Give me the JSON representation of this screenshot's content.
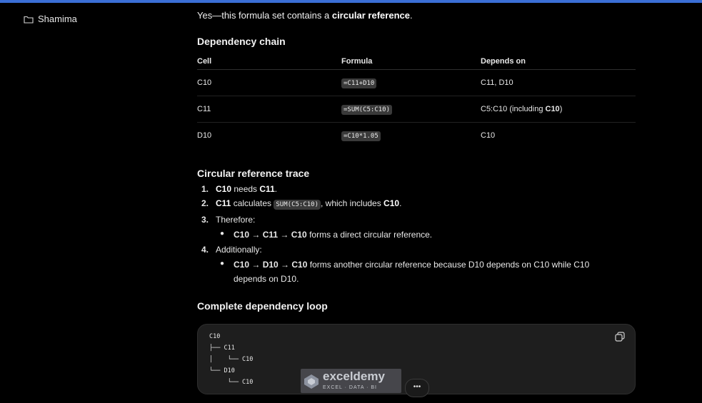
{
  "sidebar": {
    "folder_label": "Shamima"
  },
  "answer": {
    "intro_prefix": "Yes—this formula set contains a ",
    "intro_bold": "circular reference",
    "intro_suffix": ".",
    "dependency_heading": "Dependency chain",
    "table": {
      "headers": [
        "Cell",
        "Formula",
        "Depends on"
      ],
      "rows": [
        {
          "cell": "C10",
          "formula": "=C11+D10",
          "depends_prefix": "C11, D10",
          "depends_bold": "",
          "depends_suffix": ""
        },
        {
          "cell": "C11",
          "formula": "=SUM(C5:C10)",
          "depends_prefix": "C5:C10 (including ",
          "depends_bold": "C10",
          "depends_suffix": ")"
        },
        {
          "cell": "D10",
          "formula": "=C10*1.05",
          "depends_prefix": "C10",
          "depends_bold": "",
          "depends_suffix": ""
        }
      ]
    },
    "trace_heading": "Circular reference trace",
    "trace": [
      {
        "num": "1.",
        "b1": "C10",
        "t1": " needs ",
        "b2": "C11",
        "t2": "."
      },
      {
        "num": "2.",
        "b1": "C11",
        "t1": " calculates ",
        "code": "SUM(C5:C10)",
        "t2": ", which includes ",
        "b2": "C10",
        "t3": "."
      },
      {
        "num": "3.",
        "t1": "Therefore:",
        "sub": {
          "b1": "C10",
          "a1": " → ",
          "b2": "C11",
          "a2": " → ",
          "b3": "C10",
          "t": " forms a direct circular reference."
        }
      },
      {
        "num": "4.",
        "t1": "Additionally:",
        "sub": {
          "b1": "C10",
          "a1": " → ",
          "b2": "D10",
          "a2": " → ",
          "b3": "C10",
          "t": " forms another circular reference because D10 depends on C10 while C10",
          "t_line2": "depends on D10."
        }
      }
    ],
    "loop_heading": "Complete dependency loop",
    "loop_code": "C10\n├── C11\n│    └── C10\n└── D10\n     └── C10"
  },
  "watermark": {
    "name": "exceldemy",
    "tagline": "EXCEL · DATA · BI"
  },
  "more_button": "•••",
  "colors": {
    "accent_bar": "#3b6fd6",
    "background": "#000000",
    "code_bg": "#1e1e1e"
  },
  "icons": {
    "folder": "folder-icon",
    "copy": "copy-icon",
    "watermark_logo": "exceldemy-logo-icon"
  }
}
